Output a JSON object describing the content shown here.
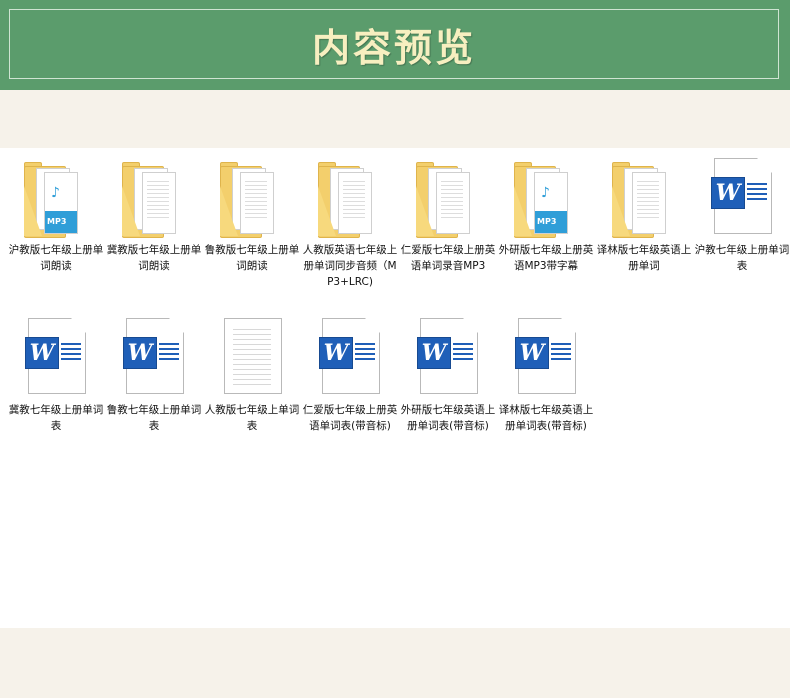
{
  "banner": {
    "title": "内容预览"
  },
  "files": [
    {
      "label": "沪教版七年级上册单词朗读",
      "icon": "audio-folder-icon"
    },
    {
      "label": "冀教版七年级上册单词朗读",
      "icon": "folder-icon"
    },
    {
      "label": "鲁教版七年级上册单词朗读",
      "icon": "folder-icon"
    },
    {
      "label": "人教版英语七年级上册单词同步音频（MP3+LRC)",
      "icon": "folder-icon"
    },
    {
      "label": "仁爱版七年级上册英语单词录音MP3",
      "icon": "folder-icon"
    },
    {
      "label": "外研版七年级上册英语MP3带字幕",
      "icon": "audio-folder-icon"
    },
    {
      "label": "译林版七年级英语上册单词",
      "icon": "folder-icon"
    },
    {
      "label": "沪教七年级上册单词表",
      "icon": "word-document-icon"
    },
    {
      "label": "冀教七年级上册单词表",
      "icon": "word-document-icon"
    },
    {
      "label": "鲁教七年级上册单词表",
      "icon": "word-document-icon"
    },
    {
      "label": "人教版七年级上单词表",
      "icon": "text-document-icon"
    },
    {
      "label": "仁爱版七年级上册英语单词表(带音标)",
      "icon": "word-document-icon"
    },
    {
      "label": "外研版七年级英语上册单词表(带音标)",
      "icon": "word-document-icon"
    },
    {
      "label": "译林版七年级英语上册单词表(带音标)",
      "icon": "word-document-icon"
    }
  ],
  "icon_text": {
    "mp3": "MP3",
    "word": "W"
  },
  "colors": {
    "banner": "#5b9c6c",
    "title": "#f7efc0",
    "folder": "#f3cf6c",
    "word_blue": "#1f5fb8",
    "mp3_blue": "#2f9ed8"
  }
}
